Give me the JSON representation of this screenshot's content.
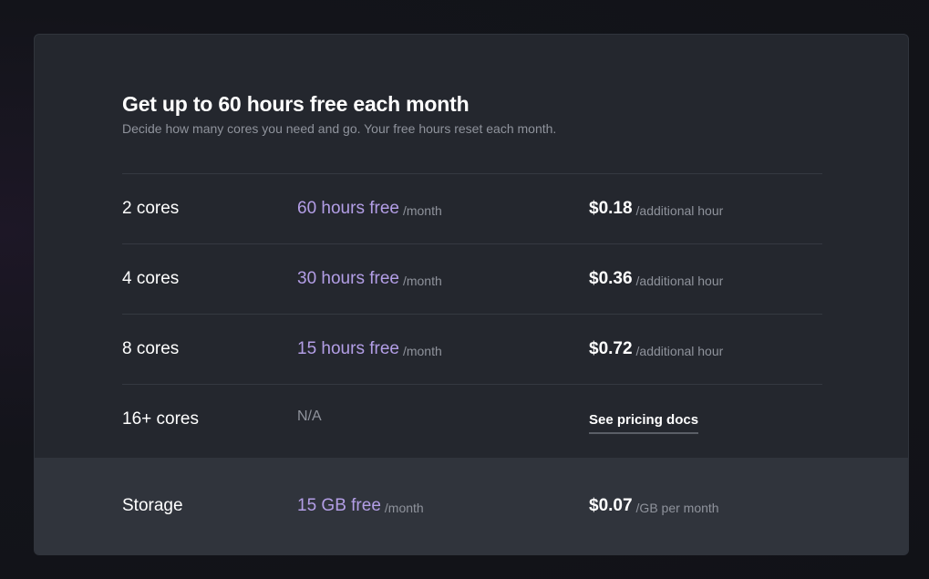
{
  "header": {
    "title": "Get up to 60 hours free each month",
    "subtitle": "Decide how many cores you need and go. Your free hours reset each month."
  },
  "rows": [
    {
      "name": "2 cores",
      "free": "60 hours free",
      "free_unit": "/month",
      "price": "$0.18",
      "price_unit": "/additional hour"
    },
    {
      "name": "4 cores",
      "free": "30 hours free",
      "free_unit": "/month",
      "price": "$0.36",
      "price_unit": "/additional hour"
    },
    {
      "name": "8 cores",
      "free": "15 hours free",
      "free_unit": "/month",
      "price": "$0.72",
      "price_unit": "/additional hour"
    },
    {
      "name": "16+ cores",
      "free": "N/A",
      "link": "See pricing docs"
    }
  ],
  "storage": {
    "name": "Storage",
    "free": "15 GB free",
    "free_unit": "/month",
    "price": "$0.07",
    "price_unit": "/GB per month"
  },
  "colors": {
    "accent": "#b39ee6",
    "card_bg": "#24272e",
    "storage_bg": "#30343c"
  }
}
